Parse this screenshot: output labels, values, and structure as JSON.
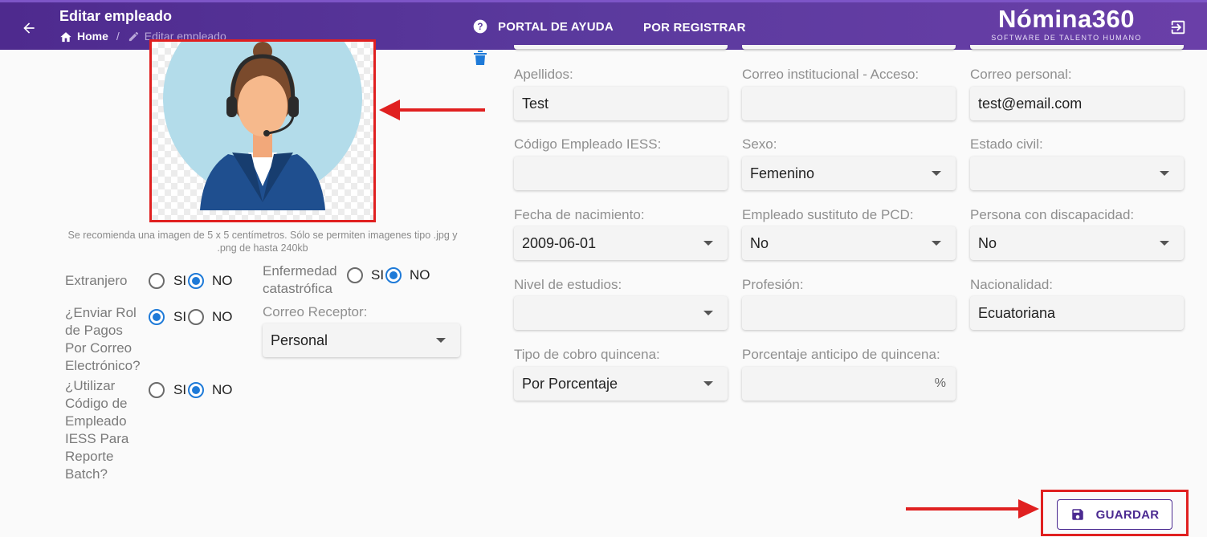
{
  "header": {
    "title": "Editar empleado",
    "breadcrumb_home": "Home",
    "breadcrumb_current": "Editar empleado",
    "help_label": "PORTAL DE AYUDA",
    "register_label": "POR REGISTRAR",
    "logo_text": "Nómina360",
    "logo_subtitle": "SOFTWARE DE TALENTO HUMANO",
    "gradient_start": "#4e2a8e",
    "gradient_end": "#6a3fa8"
  },
  "photo": {
    "note": "Se recomienda una imagen de 5 x 5 centímetros. Sólo se permiten imagenes tipo .jpg y .png de hasta 240kb"
  },
  "options": {
    "extranjero": {
      "label": "Extranjero",
      "si": "SI",
      "no": "NO",
      "selected": "NO"
    },
    "enfermedad": {
      "label": "Enfermedad catastrófica",
      "si": "SI",
      "no": "NO",
      "selected": "NO"
    },
    "enviar_rol": {
      "label": "¿Enviar Rol de Pagos Por Correo Electrónico?",
      "si": "SI",
      "no": "NO",
      "selected": "SI"
    },
    "utilizar_codigo": {
      "label": "¿Utilizar Código de Empleado IESS Para Reporte Batch?",
      "si": "SI",
      "no": "NO",
      "selected": "NO"
    },
    "correo_receptor": {
      "label": "Correo Receptor:",
      "value": "Personal"
    }
  },
  "form": {
    "apellidos": {
      "label": "Apellidos:",
      "value": "Test"
    },
    "correo_institucional": {
      "label": "Correo institucional - Acceso:",
      "value": ""
    },
    "correo_personal": {
      "label": "Correo personal:",
      "value": "test@email.com"
    },
    "codigo_iess": {
      "label": "Código Empleado IESS:",
      "value": ""
    },
    "sexo": {
      "label": "Sexo:",
      "value": "Femenino"
    },
    "estado_civil": {
      "label": "Estado civil:",
      "value": ""
    },
    "fecha_nacimiento": {
      "label": "Fecha de nacimiento:",
      "value": "2009-06-01"
    },
    "sustituto_pcd": {
      "label": "Empleado sustituto de PCD:",
      "value": "No"
    },
    "discapacidad": {
      "label": "Persona con discapacidad:",
      "value": "No"
    },
    "nivel_estudios": {
      "label": "Nivel de estudios:",
      "value": ""
    },
    "profesion": {
      "label": "Profesión:",
      "value": ""
    },
    "nacionalidad": {
      "label": "Nacionalidad:",
      "value": "Ecuatoriana"
    },
    "tipo_cobro": {
      "label": "Tipo de cobro quincena:",
      "value": "Por Porcentaje"
    },
    "porcentaje_anticipo": {
      "label": "Porcentaje anticipo de quincena:",
      "value": "",
      "suffix": "%"
    }
  },
  "actions": {
    "save_label": "GUARDAR"
  },
  "colors": {
    "accent": "#1e7ad8",
    "primary": "#4b2a91",
    "highlight": "#e02020"
  },
  "icons": [
    "back-arrow-icon",
    "home-icon",
    "pencil-icon",
    "help-circle-icon",
    "logout-icon",
    "trash-icon",
    "save-icon"
  ]
}
